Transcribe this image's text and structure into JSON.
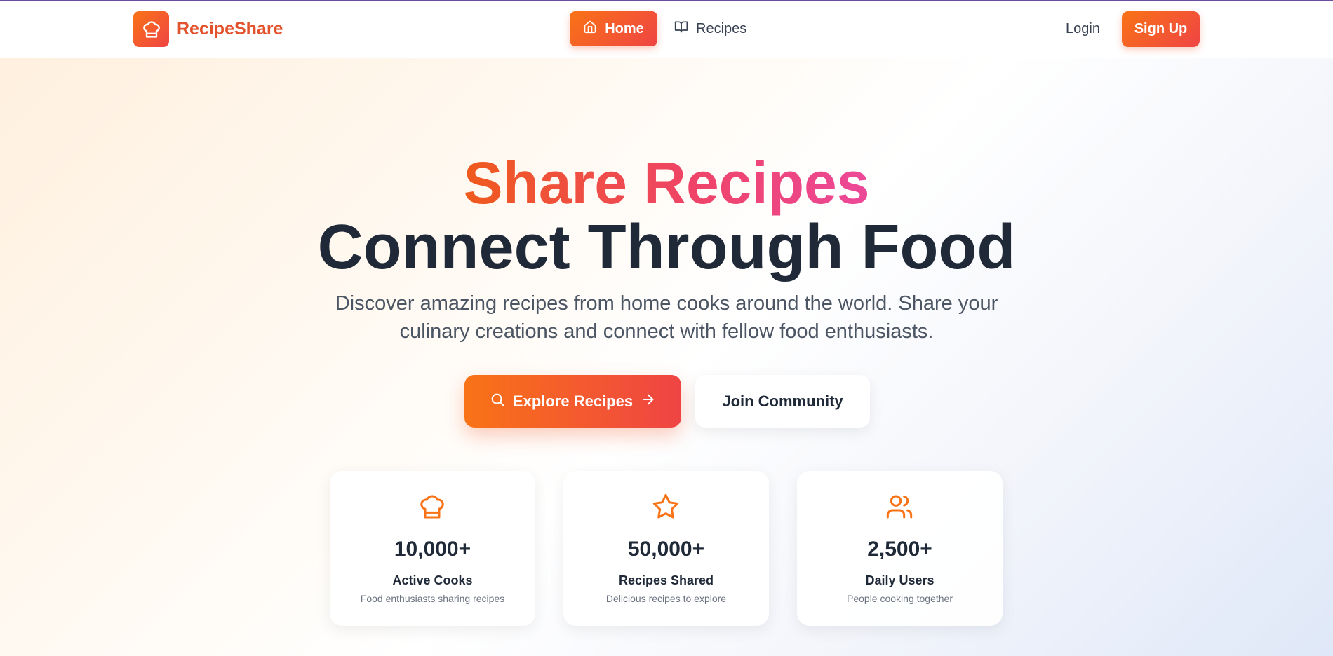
{
  "brand": {
    "name": "RecipeShare",
    "logo_icon": "chef-hat-icon"
  },
  "nav": {
    "home_label": "Home",
    "home_icon": "home-icon",
    "recipes_label": "Recipes",
    "recipes_icon": "book-open-icon",
    "login_label": "Login",
    "signup_label": "Sign Up"
  },
  "hero": {
    "title_line1": "Share Recipes",
    "title_line2": "Connect Through Food",
    "subtitle": "Discover amazing recipes from home cooks around the world. Share your culinary creations and connect with fellow food enthusiasts.",
    "explore_label": "Explore Recipes",
    "join_label": "Join Community"
  },
  "stats": [
    {
      "icon": "chef-hat-icon",
      "value": "10,000+",
      "label": "Active Cooks",
      "desc": "Food enthusiasts sharing recipes"
    },
    {
      "icon": "star-icon",
      "value": "50,000+",
      "label": "Recipes Shared",
      "desc": "Delicious recipes to explore"
    },
    {
      "icon": "users-icon",
      "value": "2,500+",
      "label": "Daily Users",
      "desc": "People cooking together"
    }
  ],
  "colors": {
    "accent_start": "#f97316",
    "accent_end": "#ef4444",
    "title_pink": "#ec4899",
    "text_dark": "#1f2937"
  }
}
